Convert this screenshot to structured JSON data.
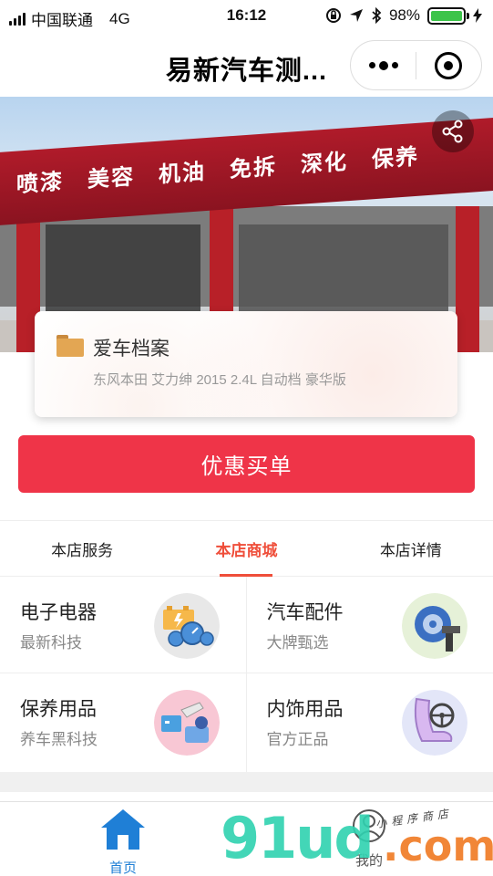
{
  "status_bar": {
    "carrier": "中国联通",
    "network": "4G",
    "time": "16:12",
    "battery": "98%"
  },
  "nav": {
    "title": "易新汽车测..."
  },
  "hero": {
    "sign_words": [
      "喷漆",
      "美容",
      "机油",
      "免拆",
      "深化",
      "保养"
    ]
  },
  "car_file": {
    "title": "爱车档案",
    "description": "东风本田 艾力绅 2015 2.4L 自动档 豪华版"
  },
  "pay_button": {
    "label": "优惠买单"
  },
  "tabs": [
    {
      "label": "本店服务",
      "active": false
    },
    {
      "label": "本店商城",
      "active": true
    },
    {
      "label": "本店详情",
      "active": false
    }
  ],
  "categories": [
    {
      "title": "电子电器",
      "subtitle": "最新科技",
      "icon": "electronics-gauge-icon"
    },
    {
      "title": "汽车配件",
      "subtitle": "大牌甄选",
      "icon": "tire-parts-icon"
    },
    {
      "title": "保养用品",
      "subtitle": "养车黑科技",
      "icon": "maintenance-tools-icon"
    },
    {
      "title": "内饰用品",
      "subtitle": "官方正品",
      "icon": "car-seat-icon"
    }
  ],
  "tabbar": {
    "home": "首页",
    "mine": "我的"
  },
  "watermark": {
    "main": "91ud",
    "com": ".com",
    "small": "小程序商店"
  },
  "colors": {
    "accent": "#ef3448",
    "tab_active": "#ef4e3a",
    "tabbar_active": "#1f7fd6"
  }
}
